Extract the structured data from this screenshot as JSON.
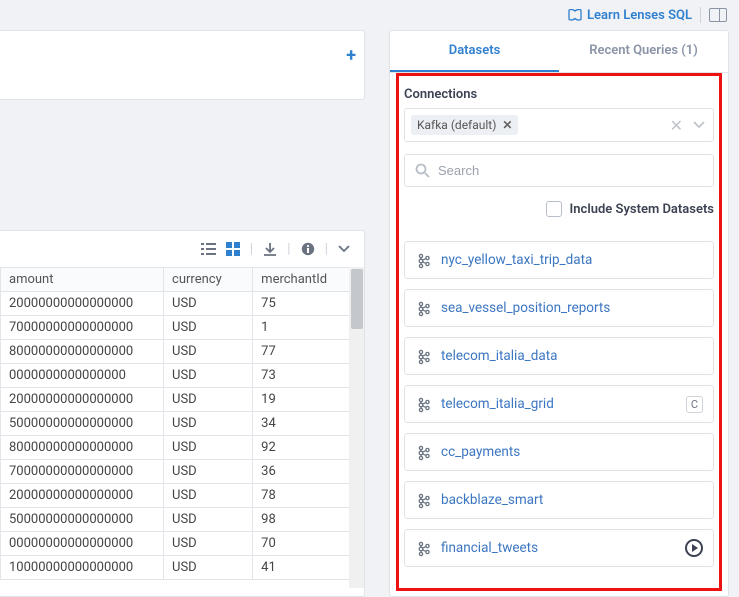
{
  "header": {
    "learn_label": "Learn Lenses SQL"
  },
  "sidebar": {
    "tabs": [
      {
        "label": "Datasets",
        "active": true
      },
      {
        "label": "Recent Queries (1)",
        "active": false
      }
    ],
    "connections_label": "Connections",
    "connection_tag": "Kafka (default)",
    "search_placeholder": "Search",
    "include_label": "Include System Datasets",
    "datasets": [
      {
        "name": "nyc_yellow_taxi_trip_data"
      },
      {
        "name": "sea_vessel_position_reports"
      },
      {
        "name": "telecom_italia_data"
      },
      {
        "name": "telecom_italia_grid",
        "badge": "C"
      },
      {
        "name": "cc_payments"
      },
      {
        "name": "backblaze_smart"
      },
      {
        "name": "financial_tweets",
        "play": true
      }
    ]
  },
  "results": {
    "columns": [
      "amount",
      "currency",
      "merchantId"
    ],
    "rows": [
      [
        "20000000000000000",
        "USD",
        "75"
      ],
      [
        "70000000000000000",
        "USD",
        "1"
      ],
      [
        "80000000000000000",
        "USD",
        "77"
      ],
      [
        "0000000000000000",
        "USD",
        "73"
      ],
      [
        "20000000000000000",
        "USD",
        "19"
      ],
      [
        "50000000000000000",
        "USD",
        "34"
      ],
      [
        "80000000000000000",
        "USD",
        "92"
      ],
      [
        "70000000000000000",
        "USD",
        "36"
      ],
      [
        "20000000000000000",
        "USD",
        "78"
      ],
      [
        "50000000000000000",
        "USD",
        "98"
      ],
      [
        "00000000000000000",
        "USD",
        "70"
      ],
      [
        "10000000000000000",
        "USD",
        "41"
      ]
    ]
  }
}
